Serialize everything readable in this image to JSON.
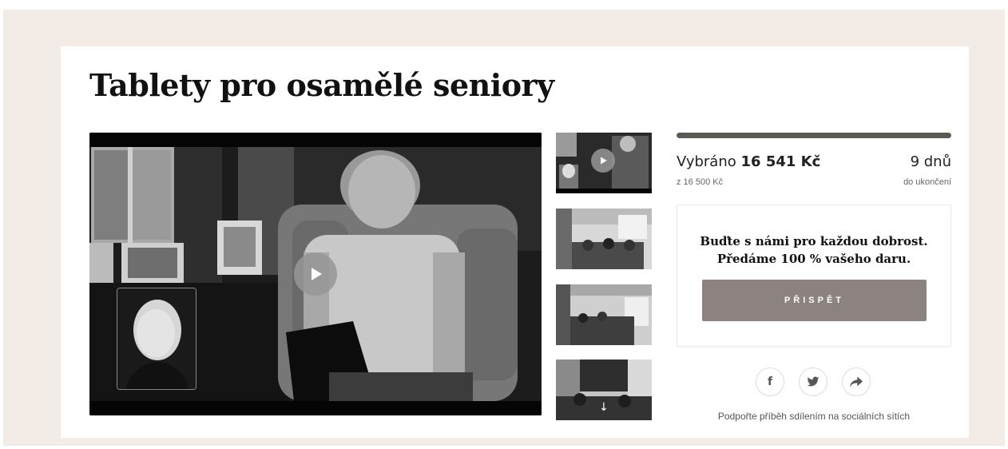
{
  "campaign": {
    "title": "Tablety pro osamělé seniory"
  },
  "video": {
    "play_icon": "play-icon"
  },
  "thumbnails": [
    {
      "icon": "play-icon"
    },
    {},
    {},
    {
      "icon": "arrow-down-icon",
      "arrow_glyph": "↓"
    }
  ],
  "funding": {
    "raised_label": "Vybráno",
    "raised_amount": "16 541 Kč",
    "goal": "z 16 500 Kč",
    "progress_percent": 100,
    "days_left": "9 dnů",
    "days_label": "do ukončení"
  },
  "donate": {
    "line1": "Buďte s námi pro každou dobrost.",
    "line2": "Předáme 100 % vašeho daru.",
    "button_label": "PŘISPĚT"
  },
  "share": {
    "facebook_glyph": "f",
    "note": "Podpořte příběh sdílením na sociálních sítích"
  },
  "colors": {
    "background": "#f3ebe6",
    "button": "#8c8381",
    "progress": "#5a5a55"
  }
}
